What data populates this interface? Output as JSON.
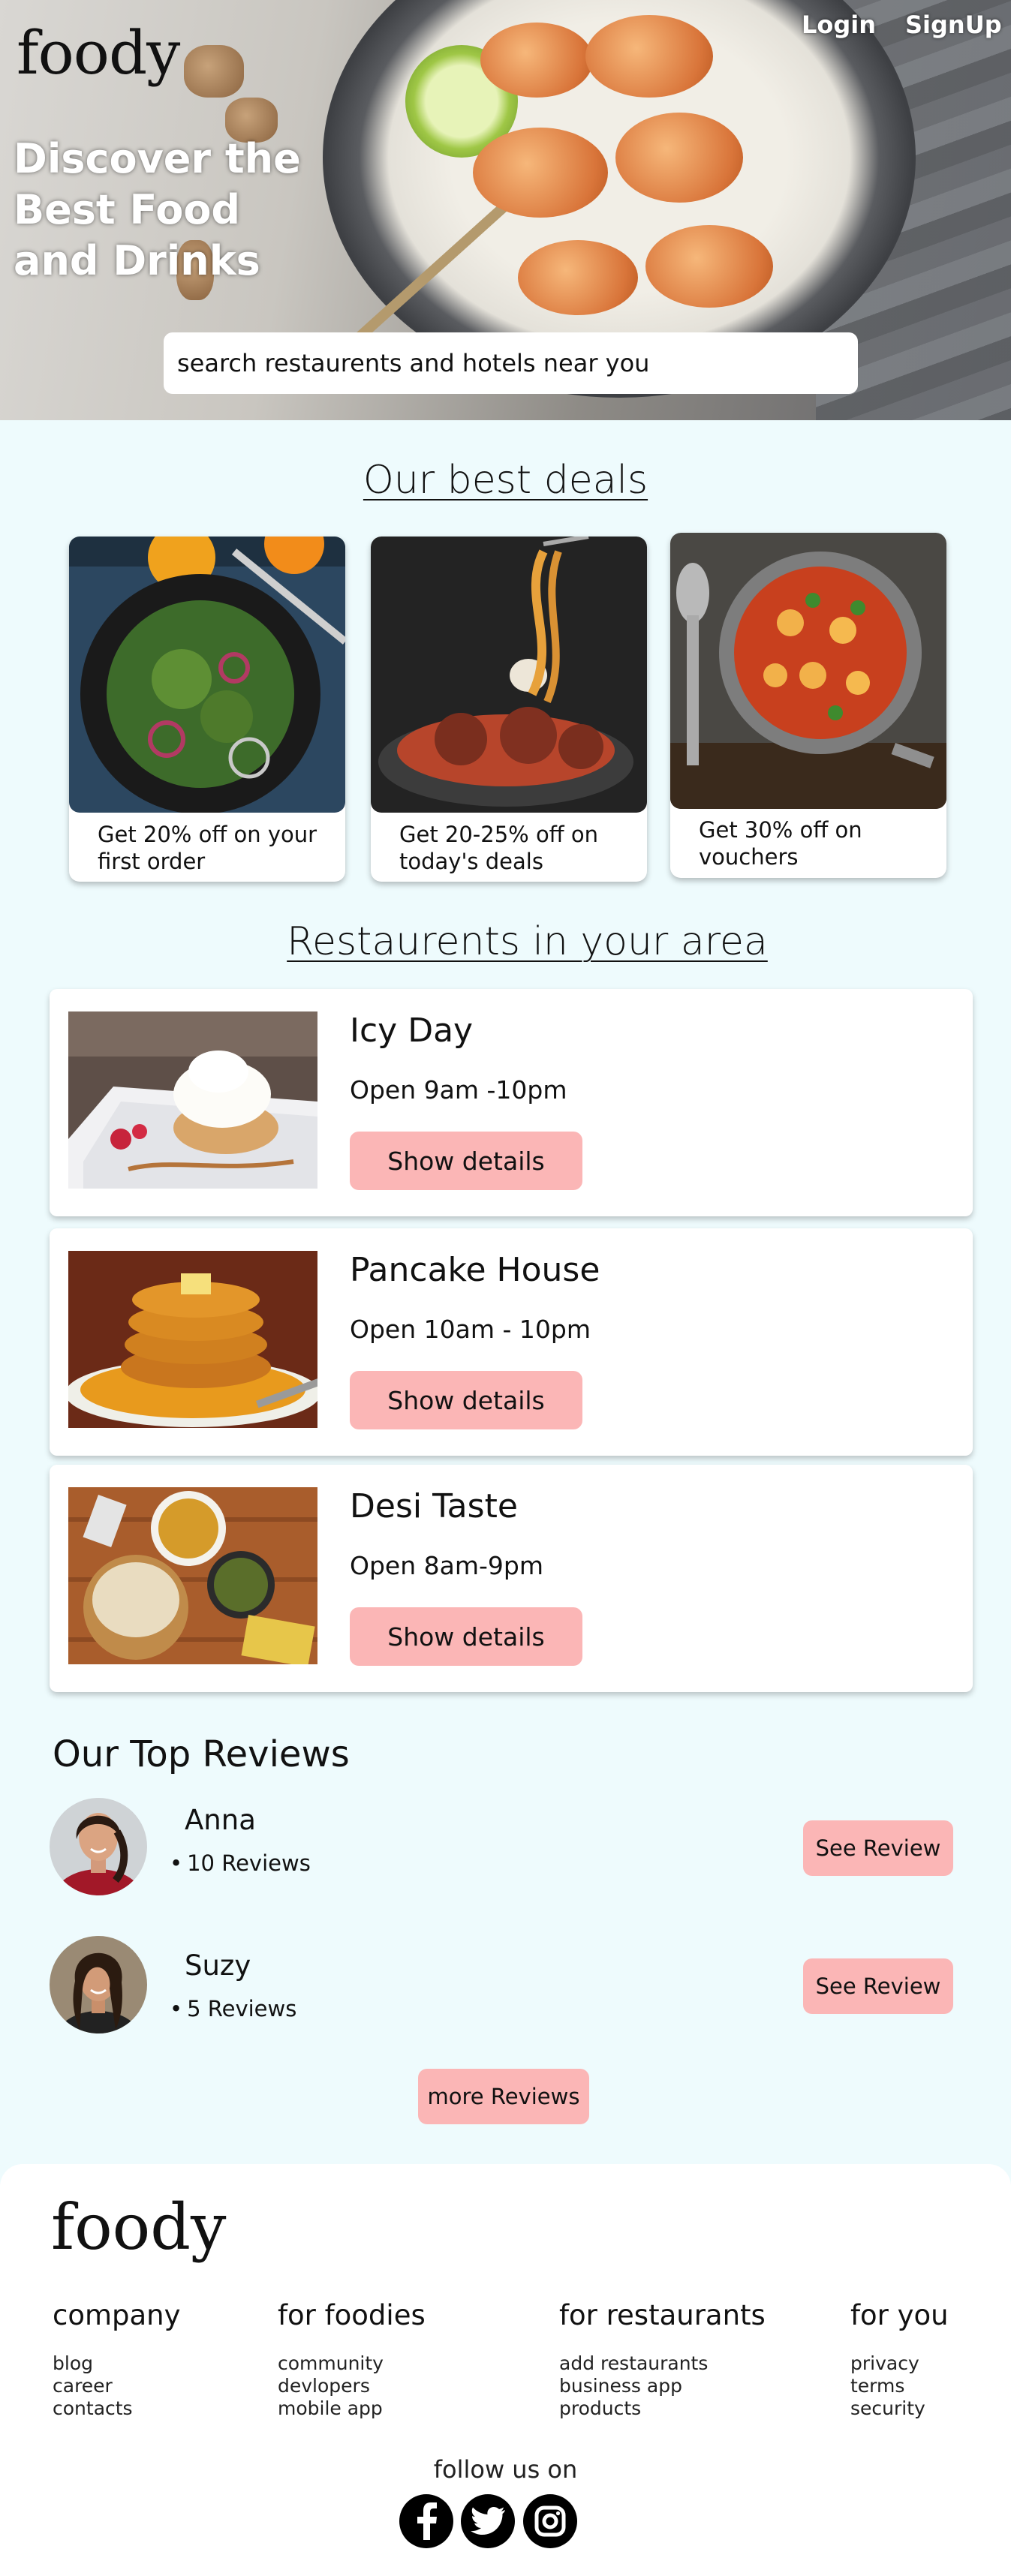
{
  "header": {
    "logo": "foody",
    "title": "Discover the Best Food and Drinks",
    "login": "Login",
    "signup": "SignUp",
    "search_placeholder": "search restaurents and hotels near you"
  },
  "deals": {
    "title": "Our best deals",
    "items": [
      {
        "caption": "Get 20% off on your first order"
      },
      {
        "caption": "Get 20-25% off on today's deals"
      },
      {
        "caption": "Get 30% off on vouchers"
      }
    ]
  },
  "restaurants": {
    "title": "Restaurents in your area",
    "items": [
      {
        "name": "Icy Day",
        "hours": "Open  9am -10pm",
        "button": "Show details"
      },
      {
        "name": "Pancake House",
        "hours": "Open 10am - 10pm",
        "button": "Show details"
      },
      {
        "name": "Desi Taste",
        "hours": "Open 8am-9pm",
        "button": "Show details"
      }
    ]
  },
  "reviews": {
    "title": "Our Top Reviews",
    "items": [
      {
        "name": "Anna",
        "count": "10 Reviews",
        "button": "See Review"
      },
      {
        "name": "Suzy",
        "count": "5 Reviews",
        "button": "See Review"
      }
    ],
    "more": "more Reviews"
  },
  "footer": {
    "logo": "foody",
    "columns": [
      {
        "heading": "company",
        "links": [
          "blog",
          "career",
          "contacts"
        ]
      },
      {
        "heading": "for foodies",
        "links": [
          "community",
          "devlopers",
          "mobile app"
        ]
      },
      {
        "heading": "for restaurants",
        "links": [
          "add restaurants",
          "business app",
          "products"
        ]
      },
      {
        "heading": "for you",
        "links": [
          "privacy",
          "terms",
          "security"
        ]
      }
    ],
    "follow": "follow us on",
    "social": [
      "facebook-icon",
      "twitter-icon",
      "instagram-icon"
    ]
  },
  "colors": {
    "accent_button": "#fbb6b6",
    "page_bg": "#eefbfd"
  }
}
